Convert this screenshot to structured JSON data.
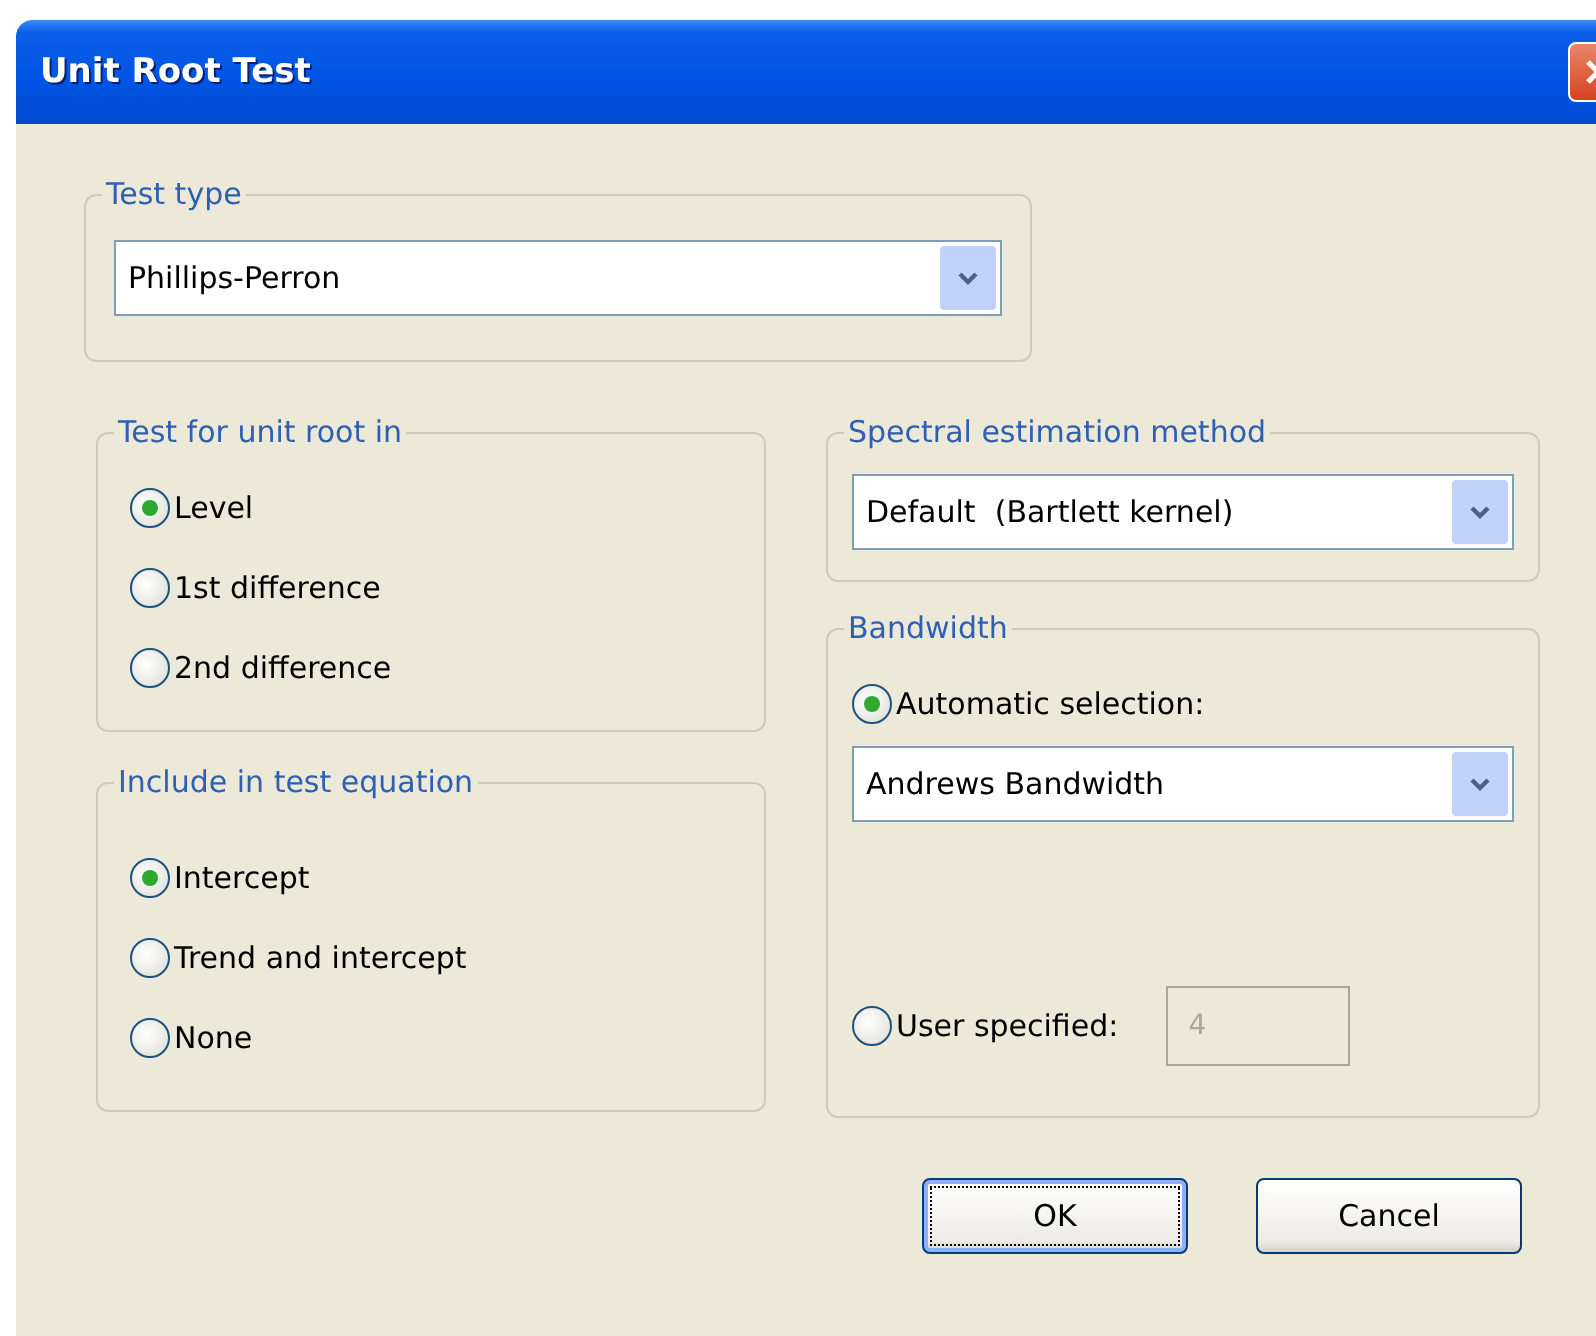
{
  "window": {
    "title": "Unit Root Test"
  },
  "test_type": {
    "legend": "Test type",
    "value": "Phillips-Perron"
  },
  "unit_root_in": {
    "legend": "Test for unit root in",
    "options": [
      {
        "label": "Level",
        "selected": true
      },
      {
        "label": "1st difference",
        "selected": false
      },
      {
        "label": "2nd difference",
        "selected": false
      }
    ]
  },
  "include": {
    "legend": "Include in test equation",
    "options": [
      {
        "label": "Intercept",
        "selected": true
      },
      {
        "label": "Trend and intercept",
        "selected": false
      },
      {
        "label": "None",
        "selected": false
      }
    ]
  },
  "spectral": {
    "legend": "Spectral estimation method",
    "value": "Default  (Bartlett kernel)"
  },
  "bandwidth": {
    "legend": "Bandwidth",
    "automatic": {
      "label": "Automatic selection:",
      "selected": true,
      "value": "Andrews Bandwidth"
    },
    "user": {
      "label": "User specified:",
      "selected": false,
      "value": "4",
      "disabled": true
    }
  },
  "buttons": [
    {
      "label": "OK",
      "focused": true
    },
    {
      "label": "Cancel",
      "focused": false
    }
  ]
}
